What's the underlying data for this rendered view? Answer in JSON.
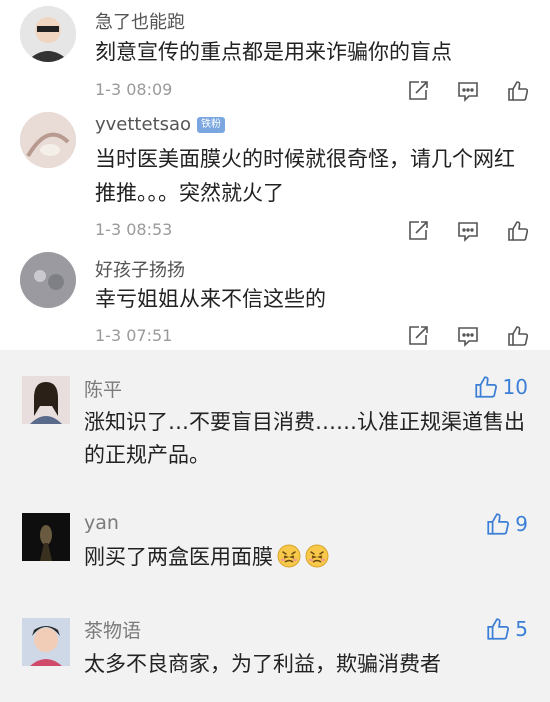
{
  "top_comments": [
    {
      "username": "急了也能跑",
      "badge": "",
      "text": "刻意宣传的重点都是用来诈骗你的盲点",
      "time": "1-3 08:09",
      "actions": [
        "share-icon",
        "comment-icon",
        "like-icon"
      ]
    },
    {
      "username": "yvettetsao",
      "badge": "铁粉",
      "text": "当时医美面膜火的时候就很奇怪，请几个网红推推。。。突然就火了",
      "time": "1-3 08:53",
      "actions": [
        "share-icon",
        "comment-icon",
        "like-icon"
      ]
    },
    {
      "username": "好孩子扬扬",
      "badge": "",
      "text": "幸亏姐姐从来不信这些的",
      "time": "1-3 07:51",
      "actions": [
        "share-icon",
        "comment-icon",
        "like-icon"
      ]
    }
  ],
  "hot_comments": [
    {
      "username": "陈平",
      "text": "涨知识了…不要盲目消费……认准正规渠道售出的正规产品。",
      "likes": "10"
    },
    {
      "username": "yan",
      "text": "刚买了两盒医用面膜",
      "likes": "9",
      "emojis": [
        "persevering-face-icon",
        "persevering-face-icon"
      ]
    },
    {
      "username": "茶物语",
      "text": "太多不良商家，为了利益，欺骗消费者",
      "likes": "5"
    }
  ],
  "colors": {
    "accent": "#3b7fd6",
    "badge": "#7aa7e0",
    "panel": "#f2f2f2"
  }
}
